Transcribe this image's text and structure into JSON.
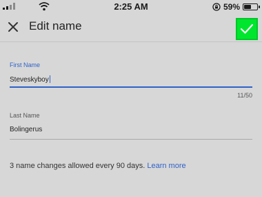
{
  "status_bar": {
    "time": "2:25 AM",
    "battery_percent": "59%",
    "battery_level": 0.59
  },
  "header": {
    "title": "Edit name",
    "close_icon": "close-icon",
    "save_icon": "checkmark-icon",
    "save_highlight_color": "#00e62e"
  },
  "form": {
    "first_name": {
      "label": "First Name",
      "value": "Steveskyboy",
      "counter": "11/50"
    },
    "last_name": {
      "label": "Last Name",
      "value": "Bolingerus"
    },
    "info_text": "3 name changes allowed every 90 days.",
    "learn_more": "Learn more"
  },
  "colors": {
    "accent": "#2f62c9",
    "background": "#d7d7d7"
  }
}
